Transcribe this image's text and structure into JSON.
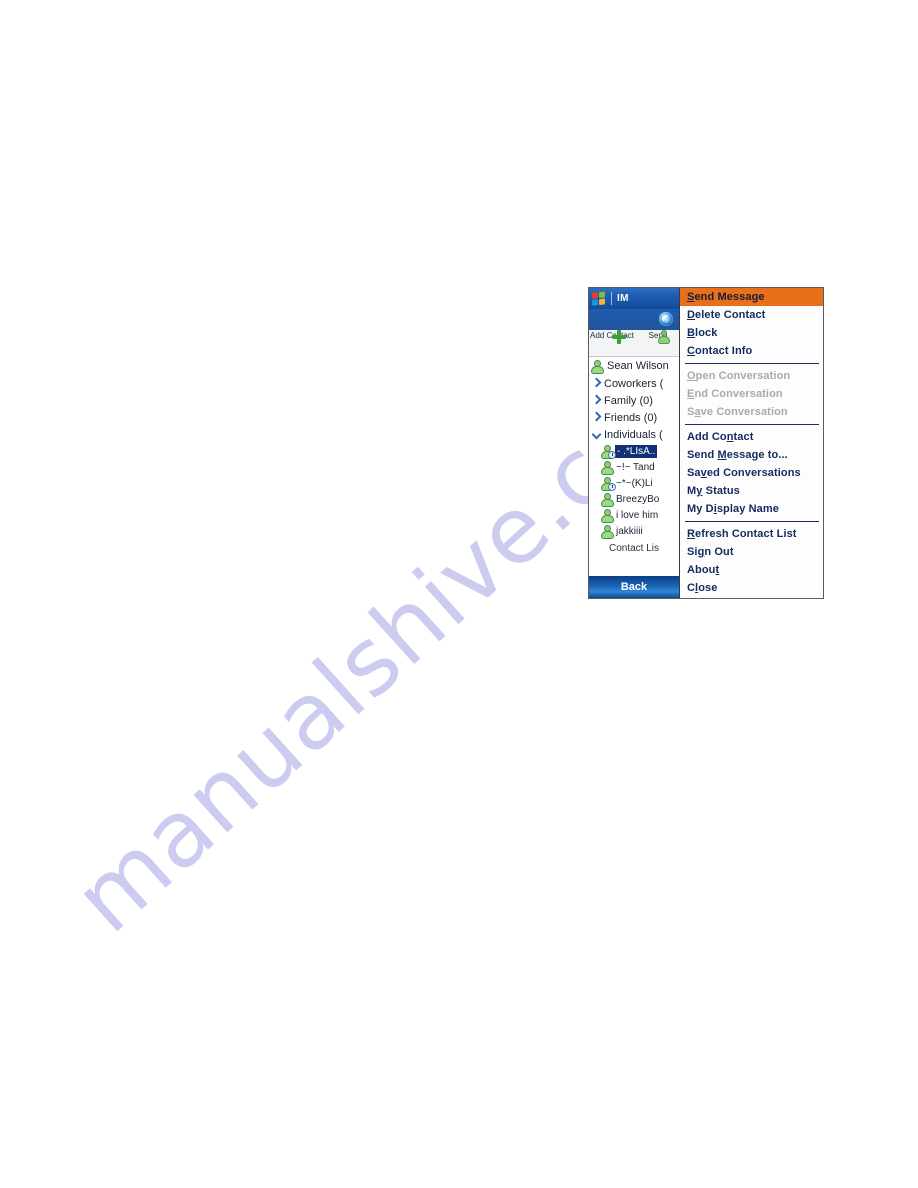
{
  "watermark": {
    "text": "manualshive.com"
  },
  "device": {
    "titlebar": {
      "app_name": "IM",
      "logo_icon": "windows-flag-icon"
    },
    "sub_band": {
      "badge_icon": "msn-messenger-icon"
    },
    "toolbar": {
      "items": [
        {
          "label": "Add Contact",
          "icon": "plus-icon"
        },
        {
          "label": "Send",
          "icon": "buddy-icon"
        }
      ]
    },
    "self": {
      "display_name": "Sean Wilson",
      "status_icon": "online-avatar-icon"
    },
    "groups": [
      {
        "label": "Coworkers (",
        "expanded": false,
        "chevron": "chevron-right-icon"
      },
      {
        "label": "Family (0)",
        "expanded": false,
        "chevron": "chevron-right-icon"
      },
      {
        "label": "Friends (0)",
        "expanded": false,
        "chevron": "chevron-right-icon"
      },
      {
        "label": "Individuals (",
        "expanded": true,
        "chevron": "chevron-down-icon"
      }
    ],
    "contacts": [
      {
        "name": "- .*LIsA..",
        "status": "away",
        "selected": true
      },
      {
        "name": "~!~ Tand",
        "status": "online",
        "selected": false
      },
      {
        "name": "~*~(K)Li",
        "status": "away",
        "selected": false
      },
      {
        "name": "BreezyBo",
        "status": "online",
        "selected": false
      },
      {
        "name": "i love him",
        "status": "online",
        "selected": false
      },
      {
        "name": "jakkiiii",
        "status": "online",
        "selected": false
      }
    ],
    "softkey_left_hint": "Contact Lis",
    "back_button": "Back"
  },
  "context_menu": {
    "groups": [
      {
        "items": [
          {
            "label": "Send Message",
            "accel_index": 0,
            "state": "highlighted"
          },
          {
            "label": "Delete Contact",
            "accel_index": 0,
            "state": "enabled"
          },
          {
            "label": "Block",
            "accel_index": 0,
            "state": "enabled"
          },
          {
            "label": "Contact Info",
            "accel_index": 0,
            "state": "enabled"
          }
        ]
      },
      {
        "items": [
          {
            "label": "Open Conversation",
            "accel_index": 0,
            "state": "disabled"
          },
          {
            "label": "End Conversation",
            "accel_index": 0,
            "state": "disabled"
          },
          {
            "label": "Save Conversation",
            "accel_index": 1,
            "state": "disabled"
          }
        ]
      },
      {
        "items": [
          {
            "label": "Add Contact",
            "accel_index": 6,
            "state": "enabled"
          },
          {
            "label": "Send Message to...",
            "accel_index": 5,
            "state": "enabled"
          },
          {
            "label": "Saved Conversations",
            "accel_index": 2,
            "state": "enabled"
          },
          {
            "label": "My Status",
            "accel_index": 1,
            "state": "enabled"
          },
          {
            "label": "My Display Name",
            "accel_index": 4,
            "state": "enabled"
          }
        ]
      },
      {
        "items": [
          {
            "label": "Refresh Contact List",
            "accel_index": 0,
            "state": "enabled"
          },
          {
            "label": "Sign Out",
            "accel_index": 2,
            "state": "enabled"
          },
          {
            "label": "About",
            "accel_index": 4,
            "state": "enabled"
          },
          {
            "label": "Close",
            "accel_index": 1,
            "state": "enabled"
          }
        ]
      }
    ]
  },
  "colors": {
    "highlight": "#e8701a",
    "menu_text": "#132a5c",
    "disabled_text": "#a9a9a9",
    "titlebar_blue": "#1d5bb0",
    "selection_navy": "#12307a",
    "watermark": "#ccccf0"
  }
}
